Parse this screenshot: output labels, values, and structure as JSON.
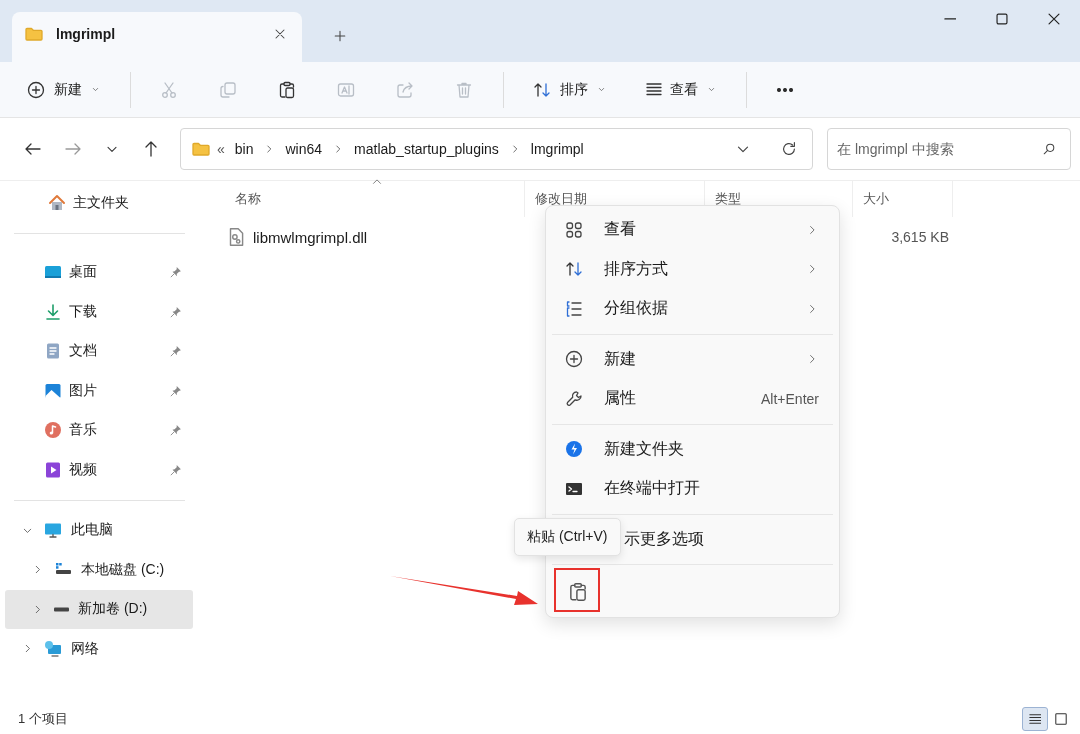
{
  "window": {
    "tab_title": "lmgrimpl",
    "controls": [
      {
        "kind": "minimize"
      },
      {
        "kind": "maximize"
      },
      {
        "kind": "close"
      }
    ]
  },
  "toolbar": {
    "groups": [
      [
        {
          "kind": "new",
          "label": "新建",
          "dropdown": true,
          "disabled": false
        }
      ],
      [
        {
          "kind": "cut",
          "disabled": true
        },
        {
          "kind": "copy",
          "disabled": true
        },
        {
          "kind": "paste",
          "disabled": false
        },
        {
          "kind": "rename",
          "disabled": true
        },
        {
          "kind": "share",
          "disabled": true
        },
        {
          "kind": "delete",
          "disabled": true
        }
      ],
      [
        {
          "kind": "sort",
          "label": "排序",
          "dropdown": true,
          "disabled": false
        },
        {
          "kind": "view",
          "label": "查看",
          "dropdown": true,
          "disabled": false
        }
      ],
      [
        {
          "kind": "more",
          "disabled": false
        }
      ]
    ]
  },
  "address": {
    "overflow": "«",
    "segments": [
      "bin",
      "win64",
      "matlab_startup_plugins",
      "lmgrimpl"
    ],
    "search_placeholder": "在 lmgrimpl 中搜索"
  },
  "sidebar": {
    "home": {
      "label": "主文件夹"
    },
    "quick_access": [
      {
        "label": "桌面",
        "kind": "desktop",
        "pinned": true
      },
      {
        "label": "下载",
        "kind": "download",
        "pinned": true
      },
      {
        "label": "文档",
        "kind": "document",
        "pinned": true
      },
      {
        "label": "图片",
        "kind": "pictures",
        "pinned": true
      },
      {
        "label": "音乐",
        "kind": "music",
        "pinned": true
      },
      {
        "label": "视频",
        "kind": "video",
        "pinned": true
      }
    ],
    "tree": [
      {
        "label": "此电脑",
        "kind": "pc",
        "expanded": true,
        "selected": false,
        "children": [
          {
            "label": "本地磁盘 (C:)",
            "kind": "drive-c",
            "expanded": false,
            "selected": false
          },
          {
            "label": "新加卷 (D:)",
            "kind": "drive",
            "expanded": false,
            "selected": true
          }
        ]
      },
      {
        "label": "网络",
        "kind": "network",
        "expanded": false,
        "selected": false
      }
    ]
  },
  "table": {
    "columns": [
      {
        "label": "名称",
        "sorted": true
      },
      {
        "label": "修改日期",
        "sorted": false
      },
      {
        "label": "类型",
        "sorted": false
      },
      {
        "label": "大小",
        "sorted": false
      }
    ],
    "rows": [
      {
        "name": "libmwlmgrimpl.dll",
        "size": "3,615 KB"
      }
    ]
  },
  "context_menu": {
    "groups": [
      [
        {
          "kind": "grid",
          "label": "查看",
          "submenu": true
        },
        {
          "kind": "sort",
          "label": "排序方式",
          "submenu": true
        },
        {
          "kind": "group",
          "label": "分组依据",
          "submenu": true
        }
      ],
      [
        {
          "kind": "new",
          "label": "新建",
          "submenu": true
        },
        {
          "kind": "wrench",
          "label": "属性",
          "shortcut": "Alt+Enter",
          "submenu": false
        }
      ],
      [
        {
          "kind": "newfolder",
          "label": "新建文件夹",
          "submenu": false
        },
        {
          "kind": "terminal",
          "label": "在终端中打开",
          "submenu": false
        }
      ],
      [
        {
          "kind": "none",
          "label": "示更多选项",
          "submenu": false
        }
      ]
    ],
    "quick_actions": [
      {
        "kind": "paste",
        "highlighted": true
      }
    ]
  },
  "tooltip": {
    "text": "粘贴 (Ctrl+V)"
  },
  "status_bar": {
    "count": "1 个项目",
    "views": [
      {
        "kind": "details",
        "selected": true
      },
      {
        "kind": "tiles",
        "selected": false
      }
    ]
  }
}
